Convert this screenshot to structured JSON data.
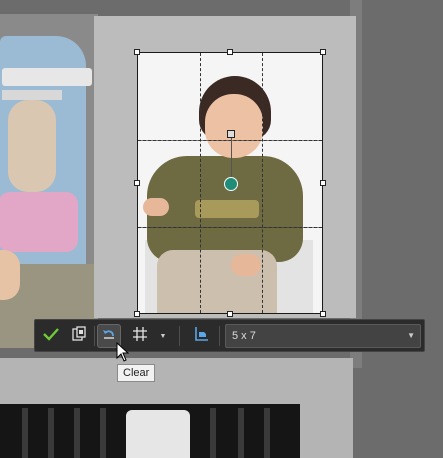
{
  "toolbar": {
    "apply_icon": "checkmark-icon",
    "save_icon": "save-crop-icon",
    "clear_icon": "undo-clear-icon",
    "grid_icon": "grid-icon",
    "dropdown_icon": "chevron-down-icon",
    "orientation_icon": "orientation-icon",
    "size_value": "5 x 7"
  },
  "tooltip": {
    "text": "Clear"
  },
  "colors": {
    "toolbar_bg": "#2b2b2b",
    "apply_check": "#6fc93a",
    "accent_blue": "#5aa6e6",
    "rotate_handle": "#1f8d78"
  }
}
